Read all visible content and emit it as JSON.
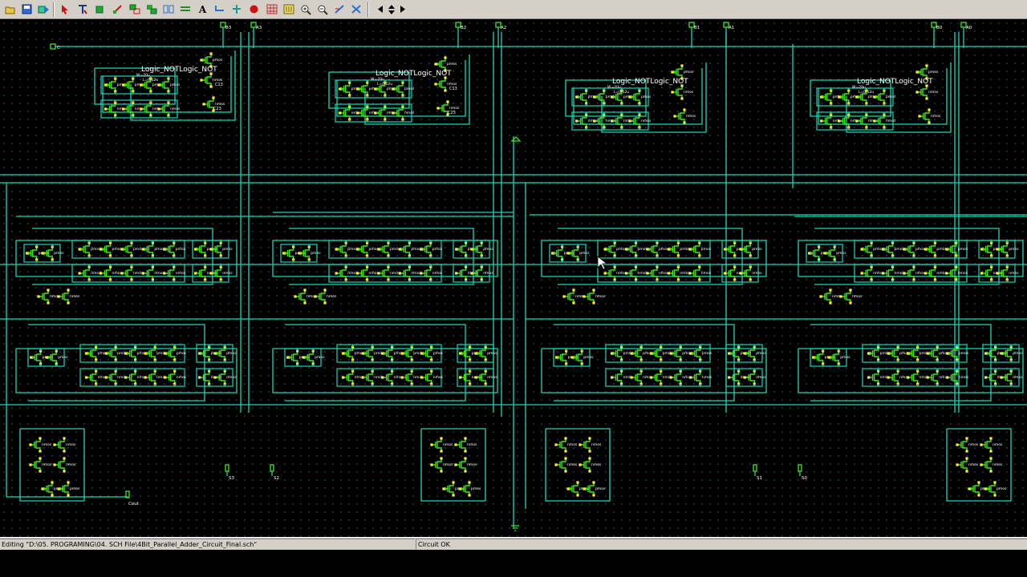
{
  "toolbar": {
    "tools": [
      {
        "name": "open-file-icon",
        "hint": "open"
      },
      {
        "name": "save-icon",
        "hint": "save"
      },
      {
        "name": "simulate-icon",
        "hint": "simulate"
      },
      {
        "name": "select-pointer-icon",
        "hint": "select"
      },
      {
        "name": "text-cursor-icon",
        "hint": "text"
      },
      {
        "name": "add-symbol-icon",
        "hint": "symbol"
      },
      {
        "name": "connect-icon",
        "hint": "connect"
      },
      {
        "name": "move-icon",
        "hint": "move"
      },
      {
        "name": "copy-icon",
        "hint": "copy"
      },
      {
        "name": "mirror-icon",
        "hint": "mirror"
      },
      {
        "name": "bus-icon",
        "hint": "bus"
      },
      {
        "name": "add-text-icon",
        "label": "A"
      },
      {
        "name": "wire-icon",
        "hint": "wire"
      },
      {
        "name": "pin-icon",
        "hint": "pin"
      },
      {
        "name": "delete-icon",
        "hint": "delete"
      },
      {
        "name": "grid-icon",
        "hint": "grid"
      },
      {
        "name": "bus-layout-icon",
        "hint": "layout"
      },
      {
        "name": "zoom-in-icon",
        "hint": "zoom in"
      },
      {
        "name": "zoom-out-icon",
        "hint": "zoom out"
      },
      {
        "name": "measure-icon",
        "hint": "measure"
      },
      {
        "name": "component-icon",
        "hint": "component"
      },
      {
        "name": "arrow-left-icon",
        "hint": "left"
      },
      {
        "name": "arrow-up-down-icon",
        "hint": "up/down"
      },
      {
        "name": "arrow-right-icon",
        "hint": "right"
      }
    ]
  },
  "schematic": {
    "wire_color": "#19d6b5",
    "device_color": "#3ce61a",
    "node_color": "#ffee33",
    "label_color": "#ffffff",
    "inputs": [
      "B3",
      "A3",
      "B2",
      "A2",
      "B1",
      "A1",
      "B0",
      "A0"
    ],
    "carry_in": "C",
    "bottom_pins": [
      "S3",
      "S2",
      "S1",
      "S0"
    ],
    "carry_out": "Cout",
    "not_labels": [
      "Logic_NOTLogic_NOT",
      "Logic_NOTLogic_NOT",
      "Logic_NOTLogic_NOT",
      "Logic_NOTLogic_NOT"
    ],
    "cap_labels": [
      "C13",
      "C23"
    ],
    "sizes": [
      "W=20u",
      "L=0.12u"
    ],
    "device_labels": [
      "pmos",
      "nmos"
    ]
  },
  "status": {
    "editing": "Editing \"D:\\05. PROGRAMING\\04. SCH File\\4Bit_Parallel_Adder_Circuit_Final.sch\"",
    "state": "Circuit OK"
  }
}
